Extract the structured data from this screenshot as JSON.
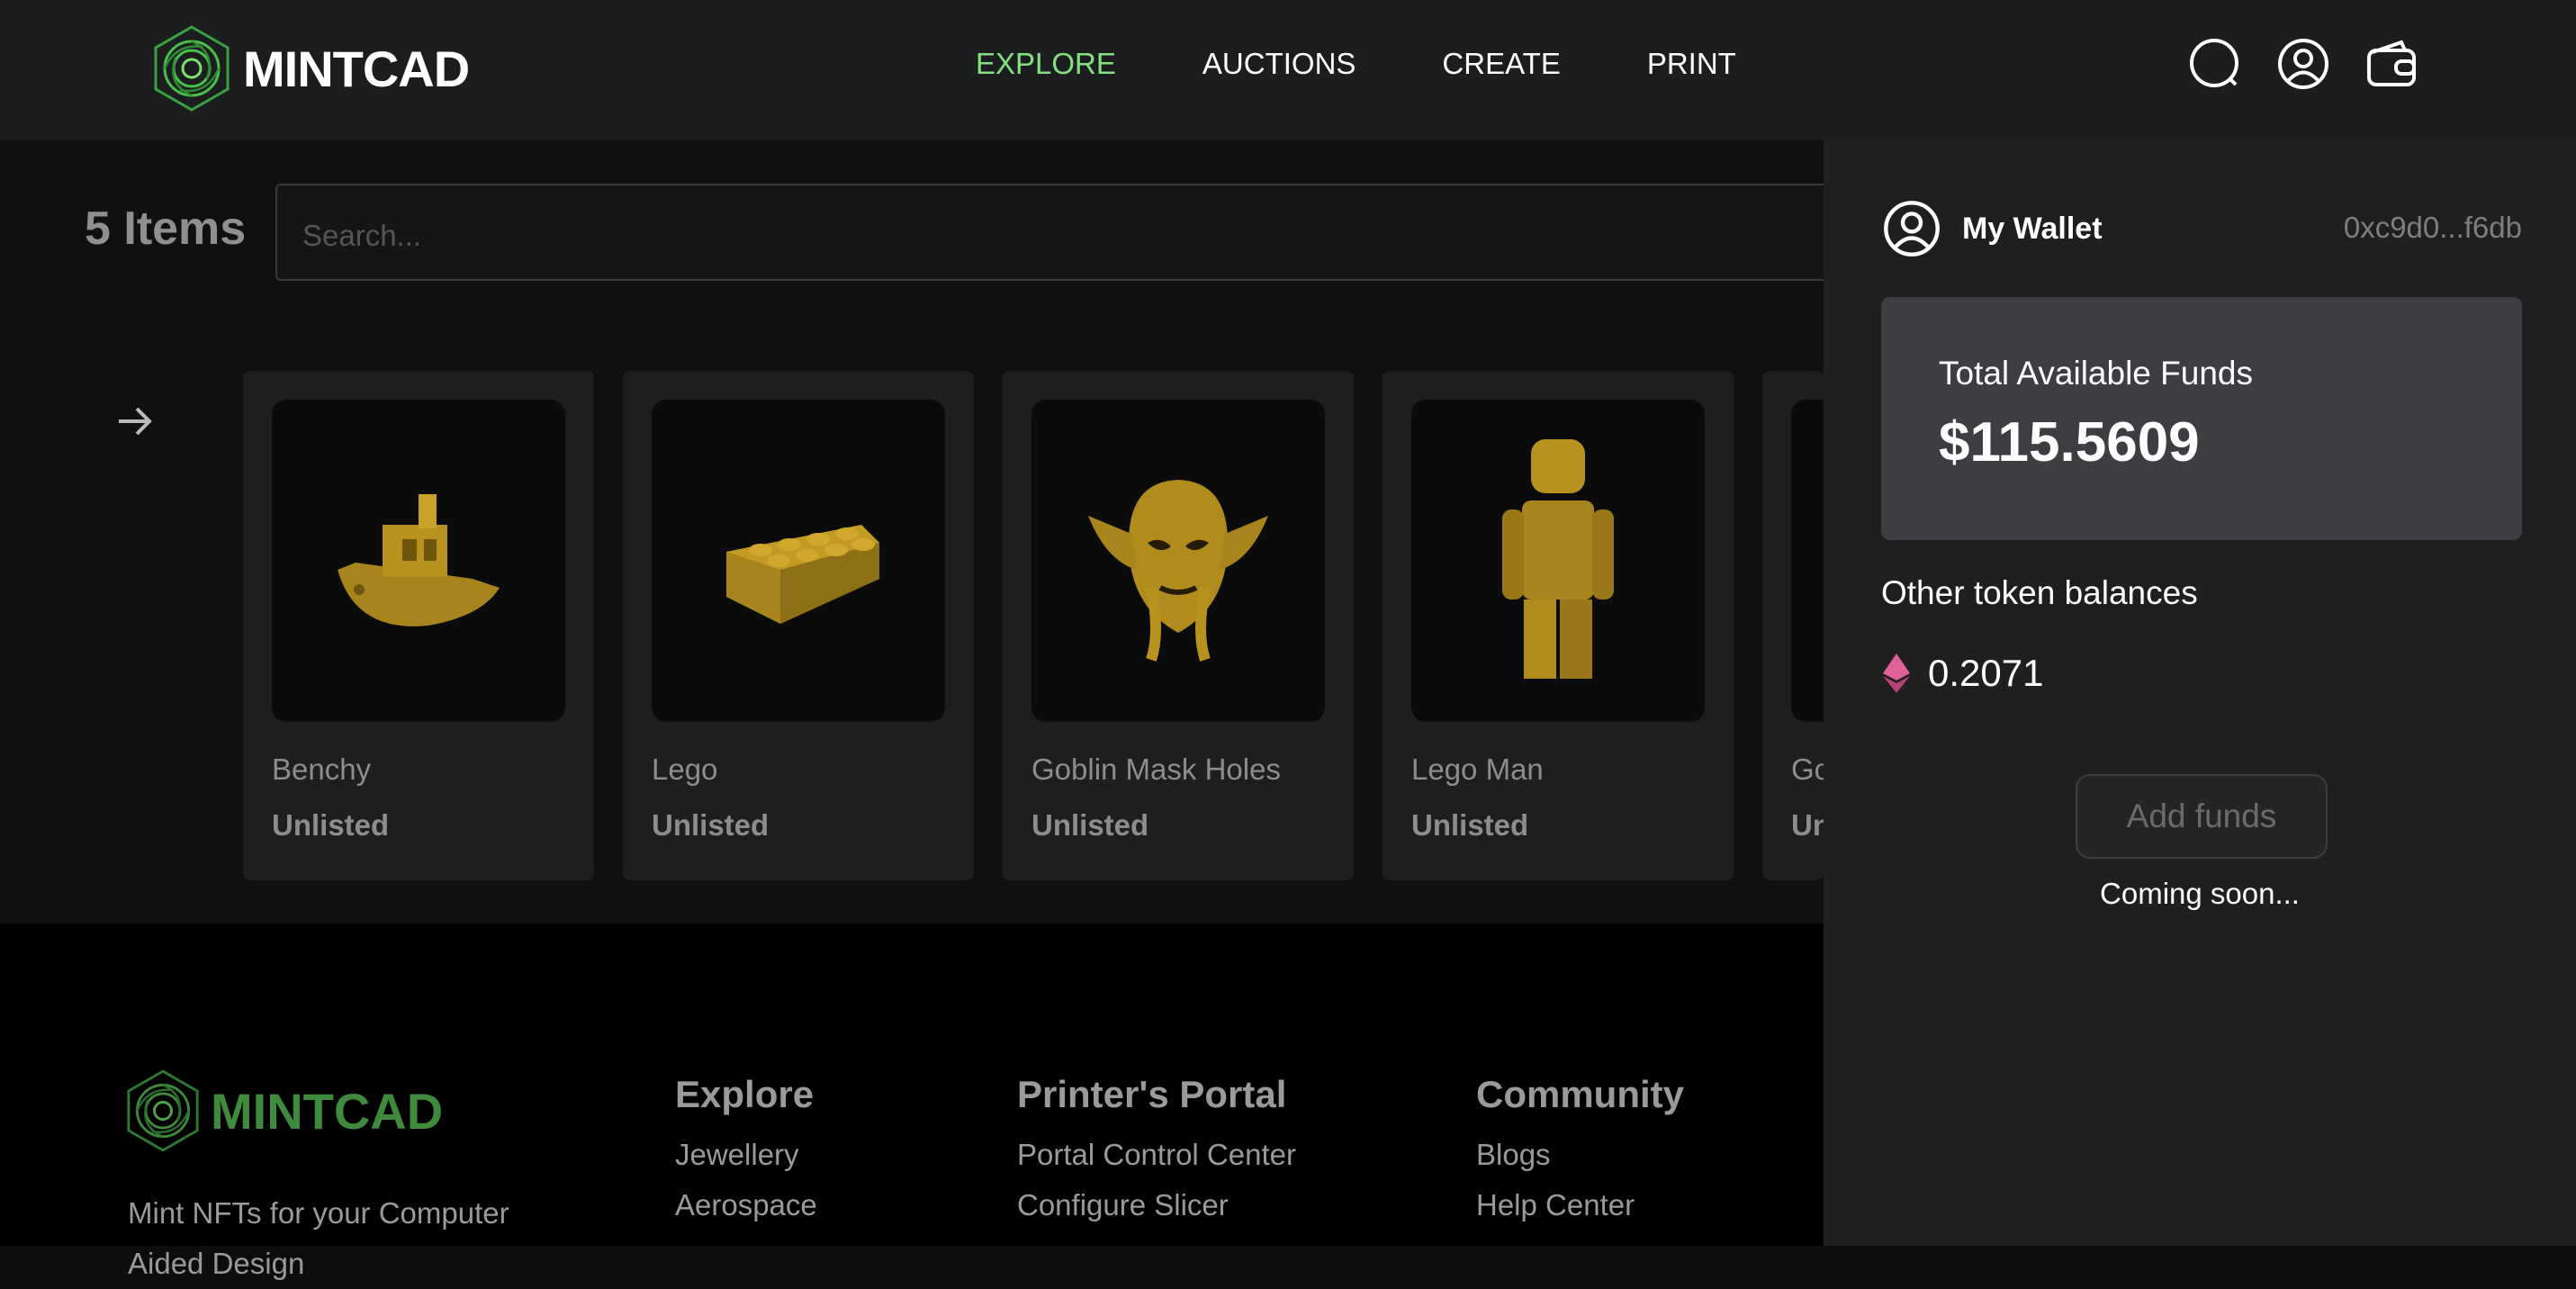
{
  "header": {
    "brand": "MINTCAD",
    "nav": [
      {
        "label": "EXPLORE",
        "active": true
      },
      {
        "label": "AUCTIONS",
        "active": false
      },
      {
        "label": "CREATE",
        "active": false
      },
      {
        "label": "PRINT",
        "active": false
      }
    ],
    "icons": [
      "search-icon",
      "account-icon",
      "wallet-icon"
    ]
  },
  "listing": {
    "count_label": "5 Items",
    "search_placeholder": "Search...",
    "cards": [
      {
        "name": "Benchy",
        "status": "Unlisted",
        "icon": "boat-model"
      },
      {
        "name": "Lego",
        "status": "Unlisted",
        "icon": "brick-model"
      },
      {
        "name": "Goblin Mask Holes",
        "status": "Unlisted",
        "icon": "mask-model"
      },
      {
        "name": "Lego Man",
        "status": "Unlisted",
        "icon": "figure-model"
      },
      {
        "name": "Go",
        "status": "Un",
        "icon": "model"
      }
    ]
  },
  "footer": {
    "brand": "MINTCAD",
    "tagline": "Mint NFTs for your Computer Aided Design",
    "columns": [
      {
        "title": "Explore",
        "links": [
          "Jewellery",
          "Aerospace"
        ]
      },
      {
        "title": "Printer's Portal",
        "links": [
          "Portal Control Center",
          "Configure Slicer"
        ]
      },
      {
        "title": "Community",
        "links": [
          "Blogs",
          "Help Center"
        ]
      }
    ]
  },
  "wallet": {
    "title": "My Wallet",
    "address": "0xc9d0...f6db",
    "funds_label": "Total Available Funds",
    "funds_value": "$115.5609",
    "other_label": "Other token balances",
    "token_value": "0.2071",
    "add_funds": "Add funds",
    "coming_soon": "Coming soon..."
  },
  "colors": {
    "accent": "#86e07f",
    "brand_green": "#3f8a3c",
    "model_gold": "#b8921f",
    "eth_pink": "#e0609a"
  }
}
